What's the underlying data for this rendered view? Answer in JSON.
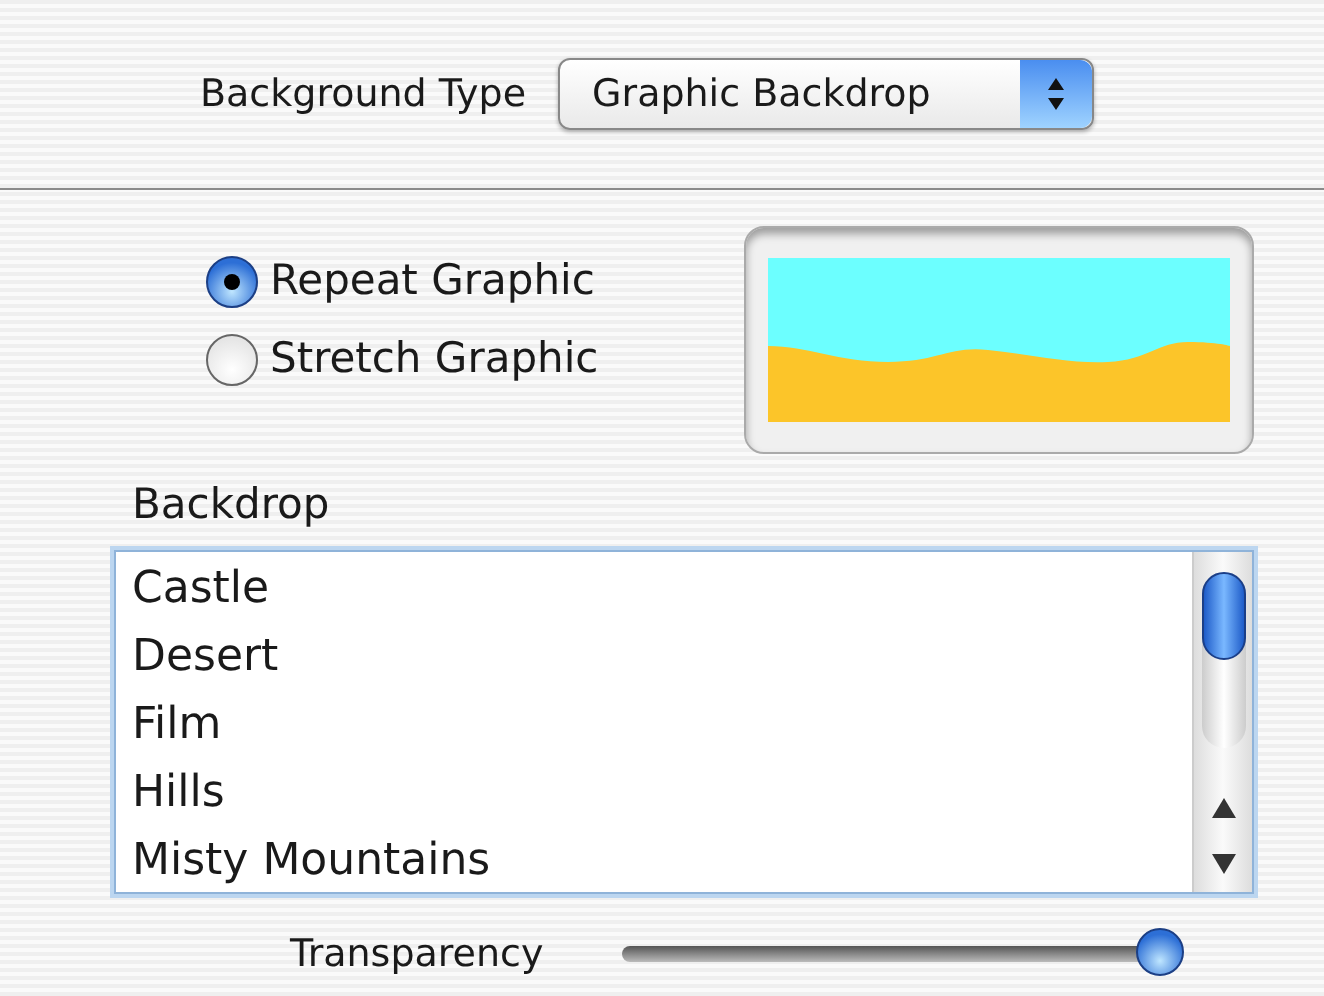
{
  "background_type": {
    "label": "Background Type",
    "value": "Graphic Backdrop"
  },
  "graphic_mode": [
    {
      "label": "Repeat Graphic",
      "selected": true
    },
    {
      "label": "Stretch Graphic",
      "selected": false
    }
  ],
  "backdrop": {
    "label": "Backdrop",
    "items": [
      {
        "label": "Castle",
        "selected": false
      },
      {
        "label": "Desert",
        "selected": false
      },
      {
        "label": "Film",
        "selected": false
      },
      {
        "label": "Hills",
        "selected": false
      },
      {
        "label": "Misty Mountains",
        "selected": false
      }
    ]
  },
  "transparency": {
    "label": "Transparency",
    "level": 0.96
  }
}
